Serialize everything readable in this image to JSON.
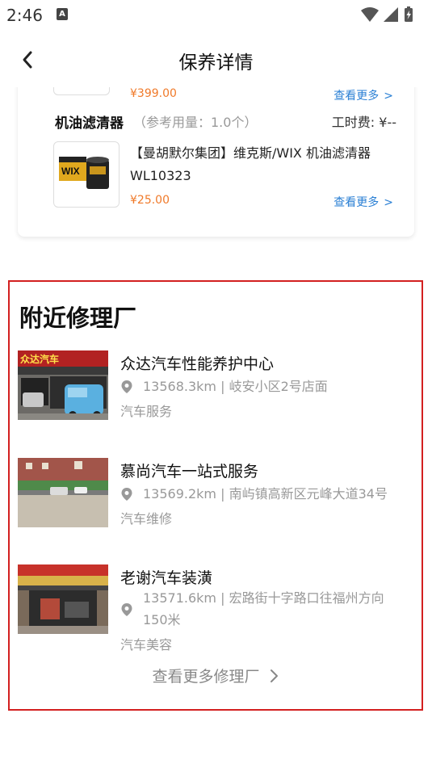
{
  "status_bar": {
    "time": "2:46",
    "notification_icon": "A"
  },
  "header": {
    "title": "保养详情"
  },
  "parts": {
    "top_item": {
      "price": "¥399.00",
      "more_label": "查看更多"
    },
    "oil_filter": {
      "name": "机油滤清器",
      "usage": "（参考用量：1.0个）",
      "labor_fee": "工时费: ¥--",
      "title": "【曼胡默尔集团】维克斯/WIX 机油滤清器 WL10323",
      "price": "¥25.00",
      "more_label": "查看更多",
      "brand_logo_text": "WIX"
    }
  },
  "nearby": {
    "title": "附近修理厂",
    "more_label": "查看更多修理厂",
    "shops": [
      {
        "name": "众达汽车性能养护中心",
        "location": "13568.3km | 岐安小区2号店面",
        "category": "汽车服务",
        "sign_text": "众达汽车"
      },
      {
        "name": "慕尚汽车一站式服务",
        "location": "13569.2km | 南屿镇高新区元峰大道34号",
        "category": "汽车维修"
      },
      {
        "name": "老谢汽车装潢",
        "location": "13571.6km | 宏路街十字路口往福州方向150米",
        "category": "汽车美容"
      }
    ]
  },
  "colors": {
    "price": "#f07a2a",
    "link": "#2a7fd4",
    "highlight_border": "#d32020"
  }
}
